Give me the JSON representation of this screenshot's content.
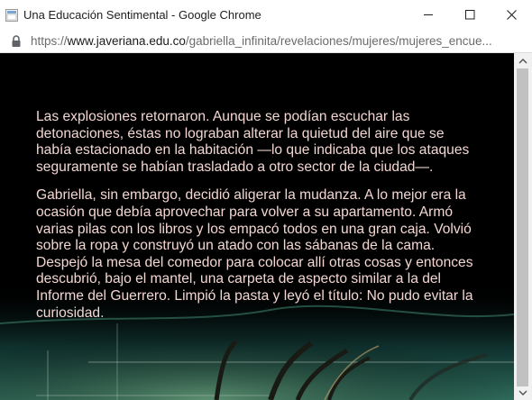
{
  "window": {
    "title": "Una Educación Sentimental - Google Chrome",
    "icons": [
      "app-icon",
      "minimize-icon",
      "maximize-icon",
      "close-icon"
    ]
  },
  "address_bar": {
    "scheme": "https://",
    "host": "www.javeriana.edu.co",
    "path": "/gabriella_infinita/revelaciones/mujeres/mujeres_encue..."
  },
  "article": {
    "paragraphs": [
      "Las explosiones retornaron. Aunque se podían escuchar las detonaciones, éstas no lograban alterar la quietud del aire que se había estacionado en la habitación —lo que indicaba que los ataques seguramente se habían trasladado a otro sector de la ciudad—.",
      "Gabriella, sin embargo, decidió aligerar la mudanza. A lo mejor era la ocasión que debía aprovechar para volver a su apartamento. Armó varias pilas con los libros y los empacó todos en una gran caja. Volvió sobre la ropa y construyó un atado con las sábanas de la cama. Despejó la mesa del comedor para colocar allí otras cosas y entonces descubrió, bajo el mantel, una carpeta de aspecto similar a la del Informe del Guerrero. Limpió la pasta y leyó el título: No pudo evitar la curiosidad."
    ],
    "text_color": "#f4d7d2",
    "background_color": "#000000"
  }
}
